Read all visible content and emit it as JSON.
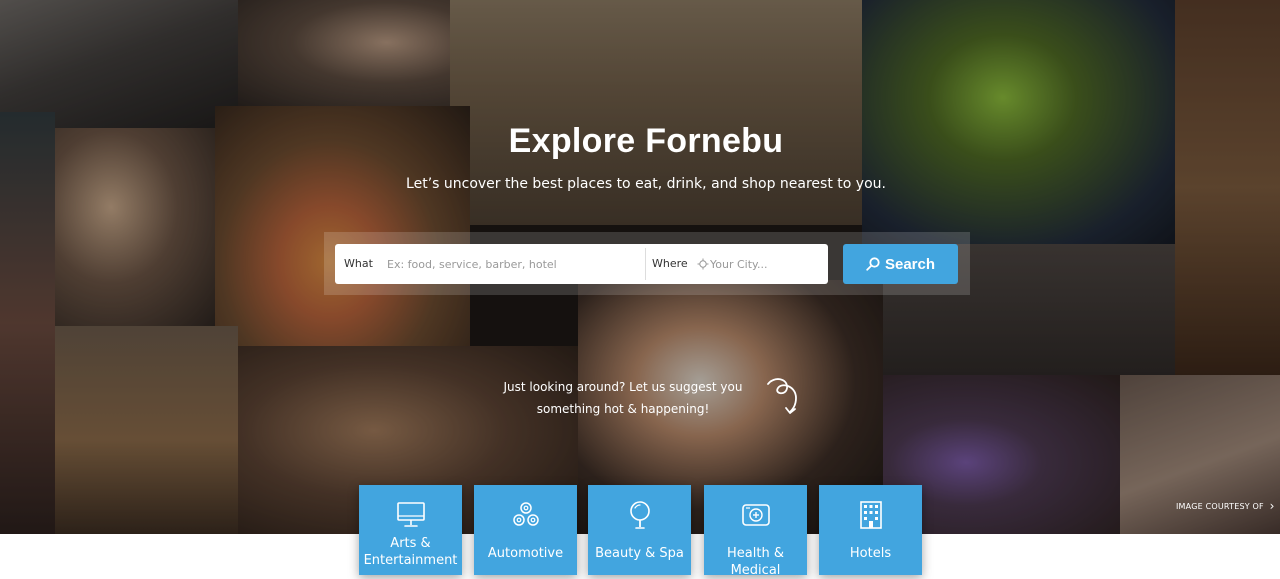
{
  "hero": {
    "title": "Explore Fornebu",
    "subtitle": "Let’s uncover the best places to eat, drink, and shop nearest to you."
  },
  "search": {
    "what_label": "What",
    "what_placeholder": "Ex: food, service, barber, hotel",
    "where_label": "Where",
    "where_placeholder": "Your City...",
    "button_label": "Search",
    "button_icon": "search-icon",
    "accent_color": "#42a5df"
  },
  "suggest": {
    "line1": "Just looking around? Let us suggest you",
    "line2": "something hot & happening!",
    "icon": "swirl-arrow-icon"
  },
  "credit": {
    "text": "IMAGE COURTESY OF",
    "arrow": "›"
  },
  "categories": [
    {
      "line1": "Arts &",
      "line2": "Entertainment",
      "icon": "monitor-icon"
    },
    {
      "label": "Automotive",
      "icon": "gears-icon"
    },
    {
      "label": "Beauty & Spa",
      "icon": "mirror-icon"
    },
    {
      "label": "Health & Medical",
      "icon": "medical-device-icon"
    },
    {
      "label": "Hotels",
      "icon": "hotel-building-icon"
    }
  ]
}
